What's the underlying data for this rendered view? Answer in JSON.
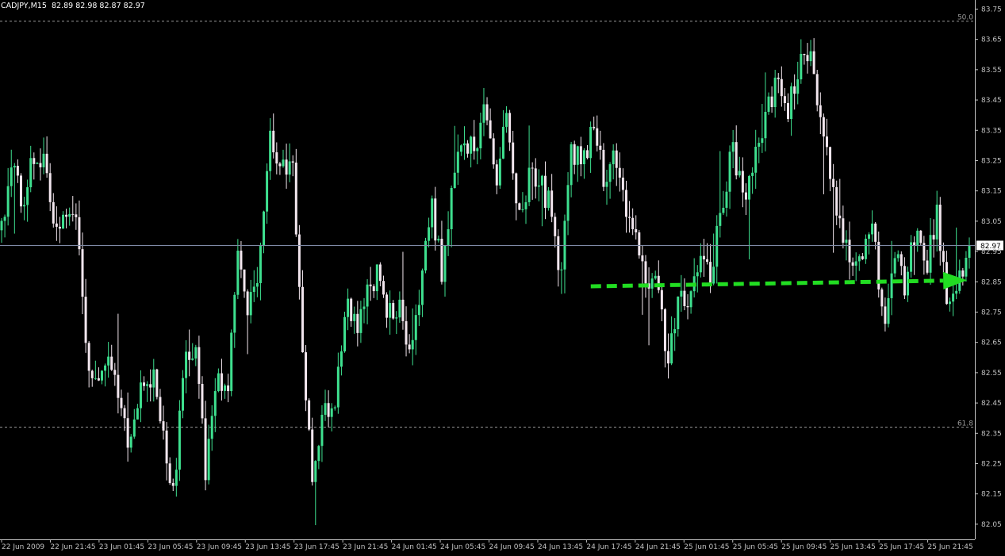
{
  "header": {
    "symbol_timeframe": "CADJPY,M15",
    "ohlc": "82.89 82.98 82.87 82.97"
  },
  "colors": {
    "background": "#000000",
    "bull_candle": "#3ee08f",
    "bear_candle": "#f2e6ee",
    "axis": "#c0c0c0",
    "grid_fib": "#9a9a9a",
    "bid_line": "#7f8aa6",
    "arrow": "#22dd22"
  },
  "chart_data": {
    "type": "candlestick",
    "instrument": "CADJPY",
    "timeframe": "M15",
    "ylim": [
      82.0,
      83.78
    ],
    "yticks": [
      "83.75",
      "83.65",
      "83.55",
      "83.45",
      "83.35",
      "83.25",
      "83.15",
      "83.05",
      "82.95",
      "82.85",
      "82.75",
      "82.65",
      "82.55",
      "82.45",
      "82.35",
      "82.25",
      "82.15",
      "82.05"
    ],
    "xticks": [
      "22 Jun 2009",
      "22 Jun 21:45",
      "23 Jun 01:45",
      "23 Jun 05:45",
      "23 Jun 09:45",
      "23 Jun 13:45",
      "23 Jun 17:45",
      "23 Jun 21:45",
      "24 Jun 01:45",
      "24 Jun 05:45",
      "24 Jun 09:45",
      "24 Jun 13:45",
      "24 Jun 17:45",
      "24 Jun 21:45",
      "25 Jun 01:45",
      "25 Jun 05:45",
      "25 Jun 09:45",
      "25 Jun 13:45",
      "25 Jun 17:45",
      "25 Jun 21:45"
    ],
    "current_price": "82.97",
    "fib_levels": [
      {
        "label": "50.0",
        "price": 83.71
      },
      {
        "label": "61.8",
        "price": 82.37
      }
    ],
    "close_path": [
      83.02,
      83.26,
      83.08,
      83.28,
      83.24,
      82.98,
      83.1,
      83.05,
      82.6,
      82.5,
      82.62,
      82.42,
      82.32,
      82.5,
      82.55,
      82.38,
      82.13,
      82.58,
      82.66,
      82.2,
      82.58,
      82.48,
      82.95,
      82.75,
      82.9,
      83.35,
      83.2,
      83.28,
      82.58,
      82.18,
      82.46,
      82.42,
      82.78,
      82.7,
      82.82,
      82.88,
      82.74,
      82.76,
      82.62,
      82.82,
      83.1,
      82.86,
      83.2,
      83.35,
      83.25,
      83.45,
      83.15,
      83.42,
      83.02,
      83.2,
      83.18,
      83.1,
      82.86,
      83.3,
      83.22,
      83.35,
      83.2,
      83.25,
      83.1,
      83.0,
      82.85,
      82.82,
      82.6,
      82.82,
      82.8,
      82.94,
      82.88,
      83.1,
      83.3,
      83.1,
      83.25,
      83.38,
      83.5,
      83.4,
      83.55,
      83.62,
      83.45,
      83.2,
      83.05,
      82.92,
      82.9,
      83.05,
      82.7,
      82.96,
      82.82,
      83.02,
      82.9,
      83.08,
      82.78,
      82.86,
      82.97
    ],
    "note": "",
    "annotations": [
      {
        "type": "dashed-arrow",
        "from": {
          "time_frac": 0.606,
          "price": 82.835
        },
        "to": {
          "time_frac": 0.992,
          "price": 82.855
        }
      }
    ]
  }
}
